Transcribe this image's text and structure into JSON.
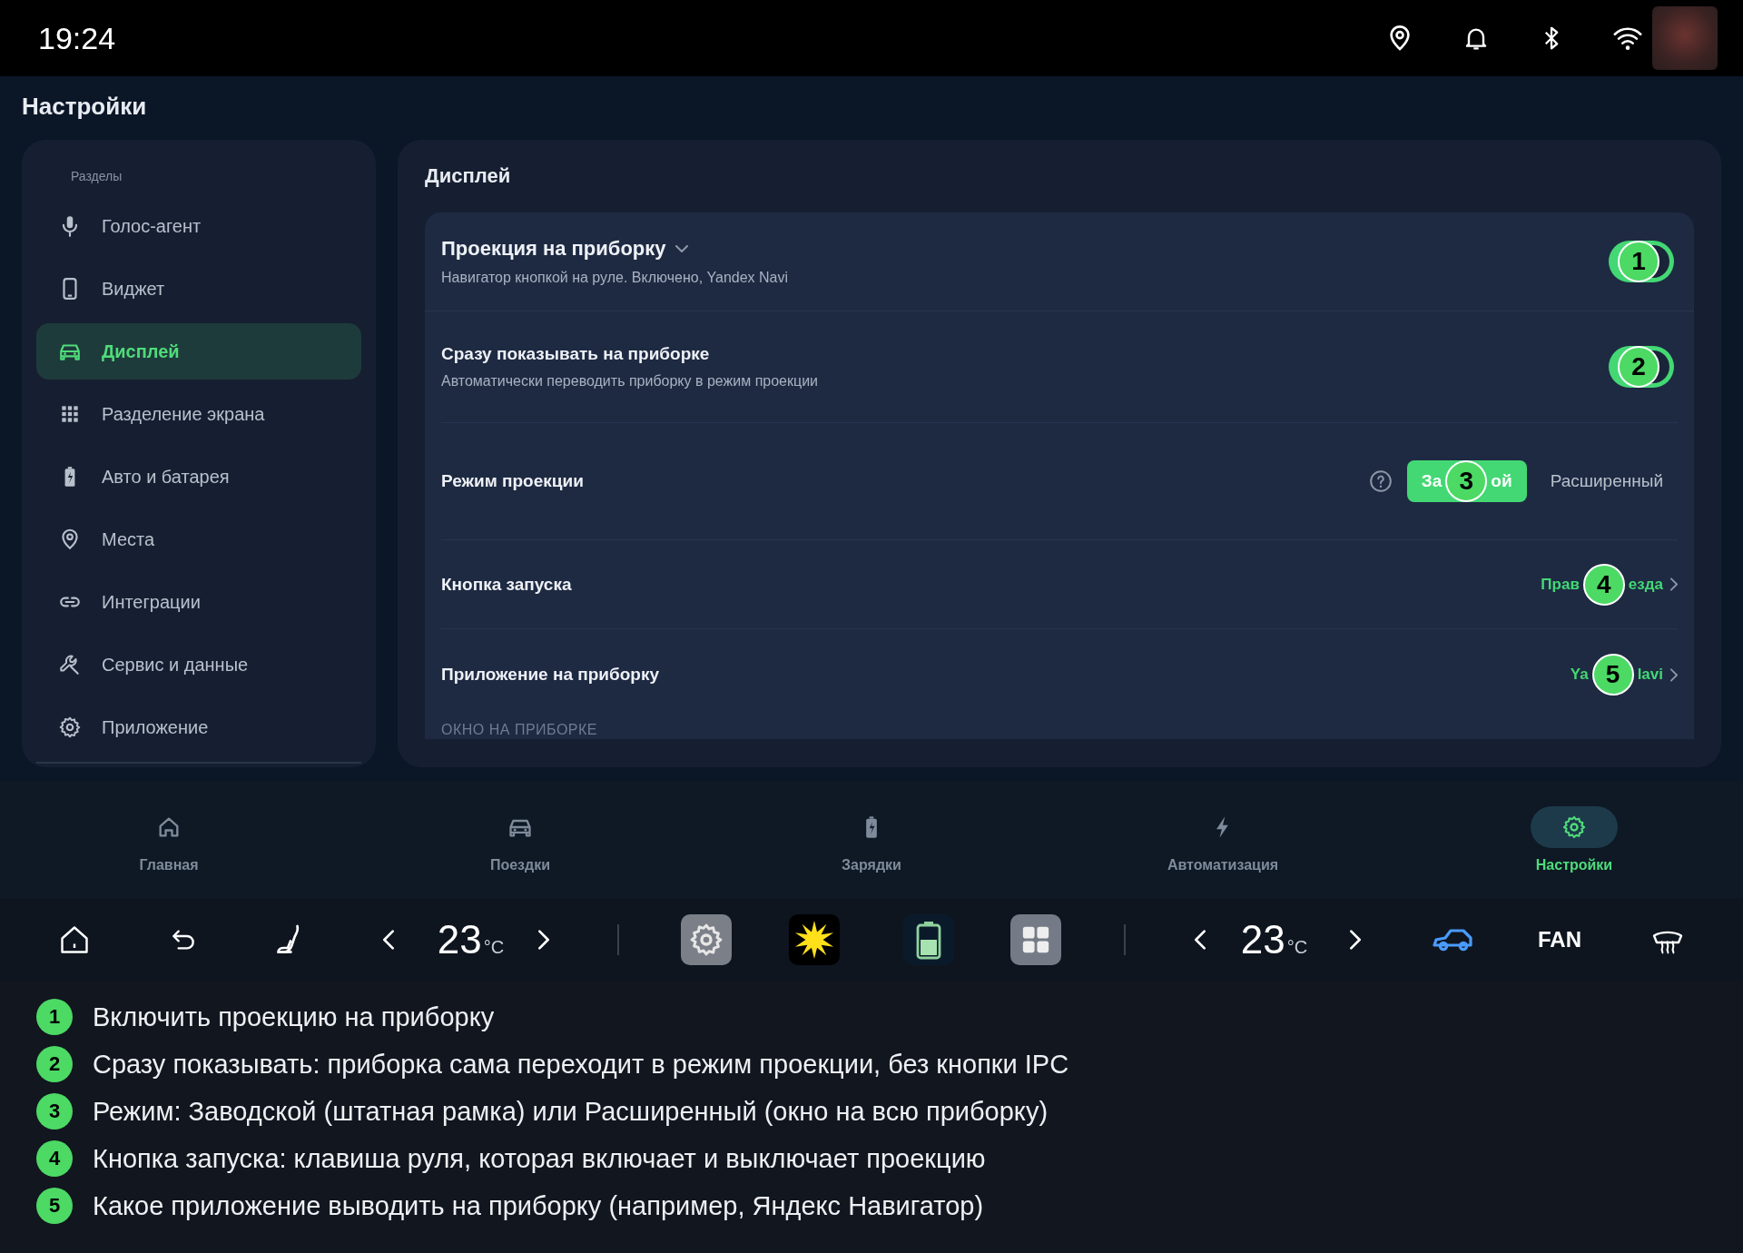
{
  "status_bar": {
    "time": "19:24"
  },
  "page_title": "Настройки",
  "sidebar": {
    "header": "Разделы",
    "items": [
      {
        "label": "Голос-агент",
        "selected": false
      },
      {
        "label": "Виджет",
        "selected": false
      },
      {
        "label": "Дисплей",
        "selected": true
      },
      {
        "label": "Разделение экрана",
        "selected": false
      },
      {
        "label": "Авто и батарея",
        "selected": false
      },
      {
        "label": "Места",
        "selected": false
      },
      {
        "label": "Интеграции",
        "selected": false
      },
      {
        "label": "Сервис и данные",
        "selected": false
      },
      {
        "label": "Приложение",
        "selected": false
      }
    ]
  },
  "content": {
    "title": "Дисплей",
    "rows": [
      {
        "kind": "toggle",
        "title": "Проекция на приборку",
        "subtitle": "Навигатор кнопкой на руле. Включено, Yandex Navi",
        "expandable": true,
        "on": true,
        "marker": "1"
      },
      {
        "kind": "toggle",
        "title": "Сразу показывать на приборке",
        "subtitle": "Автоматически переводить приборку в режим проекции",
        "expandable": false,
        "on": true,
        "marker": "2"
      },
      {
        "kind": "segmented",
        "title": "Режим проекции",
        "options": [
          {
            "text_parts": [
              "За",
              "ой"
            ],
            "selected": true,
            "marker": "3"
          },
          {
            "text_parts": [
              "Расширенный"
            ],
            "selected": false
          }
        ]
      },
      {
        "kind": "link",
        "title": "Кнопка запуска",
        "value_parts": [
          "Прав",
          "езда"
        ],
        "marker": "4"
      },
      {
        "kind": "link",
        "title": "Приложение на приборку",
        "value_parts": [
          "Ya",
          "lavi"
        ],
        "marker": "5"
      }
    ],
    "section_label": "ОКНО НА ПРИБОРКЕ"
  },
  "nav": [
    {
      "label": "Главная",
      "selected": false
    },
    {
      "label": "Поездки",
      "selected": false
    },
    {
      "label": "Зарядки",
      "selected": false
    },
    {
      "label": "Автоматизация",
      "selected": false
    },
    {
      "label": "Настройки",
      "selected": true
    }
  ],
  "climate": {
    "left_temp": {
      "value": "23",
      "unit": "°C"
    },
    "right_temp": {
      "value": "23",
      "unit": "°C"
    },
    "fan_label": "FAN"
  },
  "annotations": [
    {
      "number": "1",
      "text": "Включить проекцию на приборку"
    },
    {
      "number": "2",
      "text": "Сразу показывать: приборка сама переходит в режим проекции, без кнопки IPC"
    },
    {
      "number": "3",
      "text": "Режим: Заводской (штатная рамка) или Расширенный (окно на всю приборку)"
    },
    {
      "number": "4",
      "text": "Кнопка запуска: клавиша руля, которая включает и выключает проекцию"
    },
    {
      "number": "5",
      "text": "Какое приложение выводить на приборку (например, Яндекс Навигатор)"
    }
  ]
}
